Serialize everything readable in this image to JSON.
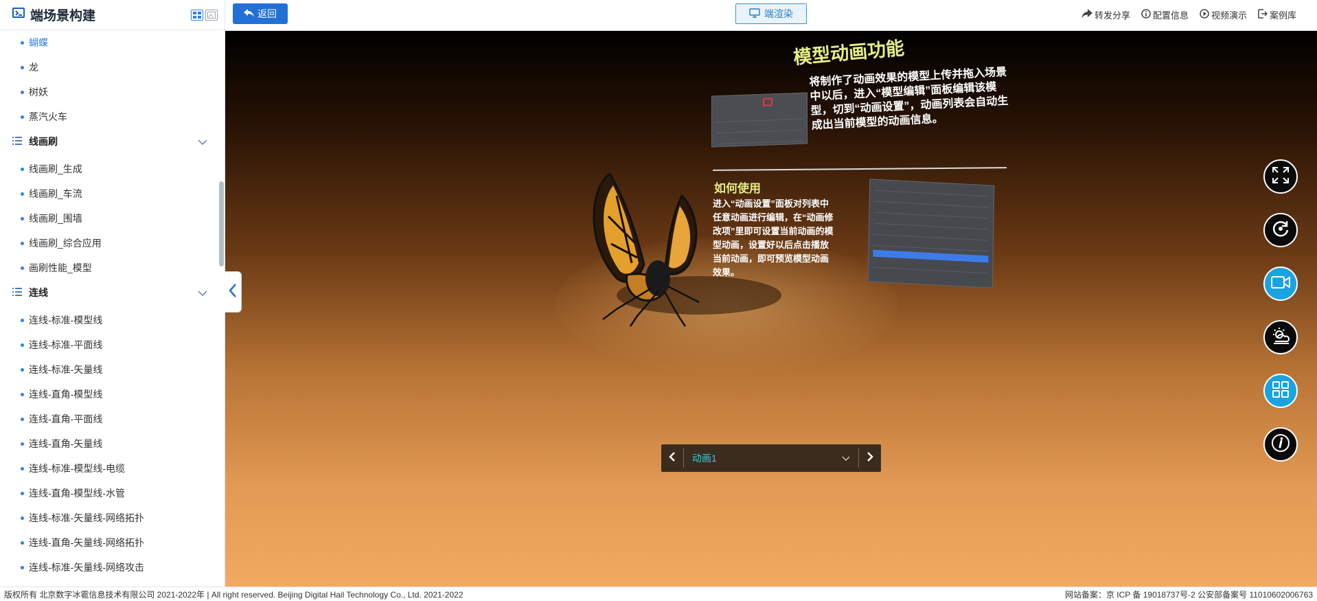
{
  "app": {
    "title": "端场景构建"
  },
  "sidebar": {
    "items_top": [
      {
        "label": "蝴蝶",
        "active": true
      },
      {
        "label": "龙"
      },
      {
        "label": "树妖"
      },
      {
        "label": "蒸汽火车"
      }
    ],
    "group1": {
      "label": "线画刷"
    },
    "group1_items": [
      {
        "label": "线画刷_生成"
      },
      {
        "label": "线画刷_车流"
      },
      {
        "label": "线画刷_围墙"
      },
      {
        "label": "线画刷_综合应用"
      },
      {
        "label": "画刷性能_模型"
      }
    ],
    "group2": {
      "label": "连线"
    },
    "group2_items": [
      {
        "label": "连线-标准-模型线"
      },
      {
        "label": "连线-标准-平面线"
      },
      {
        "label": "连线-标准-矢量线"
      },
      {
        "label": "连线-直角-模型线"
      },
      {
        "label": "连线-直角-平面线"
      },
      {
        "label": "连线-直角-矢量线"
      },
      {
        "label": "连线-标准-模型线-电缆"
      },
      {
        "label": "连线-直角-模型线-水管"
      },
      {
        "label": "连线-标准-矢量线-网络拓扑"
      },
      {
        "label": "连线-直角-矢量线-网络拓扑"
      },
      {
        "label": "连线-标准-矢量线-网络攻击"
      }
    ]
  },
  "toolbar": {
    "back_label": "返回",
    "render_label": "端渲染",
    "actions": [
      {
        "label": "转发分享",
        "icon": "share-icon"
      },
      {
        "label": "配置信息",
        "icon": "info-icon"
      },
      {
        "label": "视频演示",
        "icon": "play-icon"
      },
      {
        "label": "案例库",
        "icon": "export-icon"
      }
    ]
  },
  "scene": {
    "card_title": "模型动画功能",
    "card_text": "将制作了动画效果的模型上传并拖入场景中以后，进入“模型编辑”面板编辑该模型，切到“动画设置”，动画列表会自动生成出当前模型的动画信息。",
    "card_subtitle": "如何使用",
    "card_text2": "进入“动画设置”面板对列表中任意动画进行编辑，在“动画修改项”里即可设置当前动画的模型动画，设置好以后点击播放当前动画，即可预览模型动画效果。",
    "animation_select": "动画1"
  },
  "right_tools": [
    {
      "name": "fullscreen-icon",
      "style": "dark"
    },
    {
      "name": "rotate-icon",
      "style": "dark"
    },
    {
      "name": "video-icon",
      "style": "blue"
    },
    {
      "name": "weather-icon",
      "style": "dark"
    },
    {
      "name": "grid-icon",
      "style": "blue"
    },
    {
      "name": "info-icon",
      "style": "dark"
    }
  ],
  "footer": {
    "copyright": "版权所有 北京数字冰雹信息技术有限公司 2021-2022年 | All right reserved. Beijing Digital Hail Technology Co., Ltd. 2021-2022",
    "icp": "网站备案：京 ICP 备 19018737号-2 公安部备案号 11010602006763"
  },
  "colors": {
    "accent": "#2170d6",
    "scene_title": "#e6ee86",
    "anim_text": "#29d3e8"
  }
}
